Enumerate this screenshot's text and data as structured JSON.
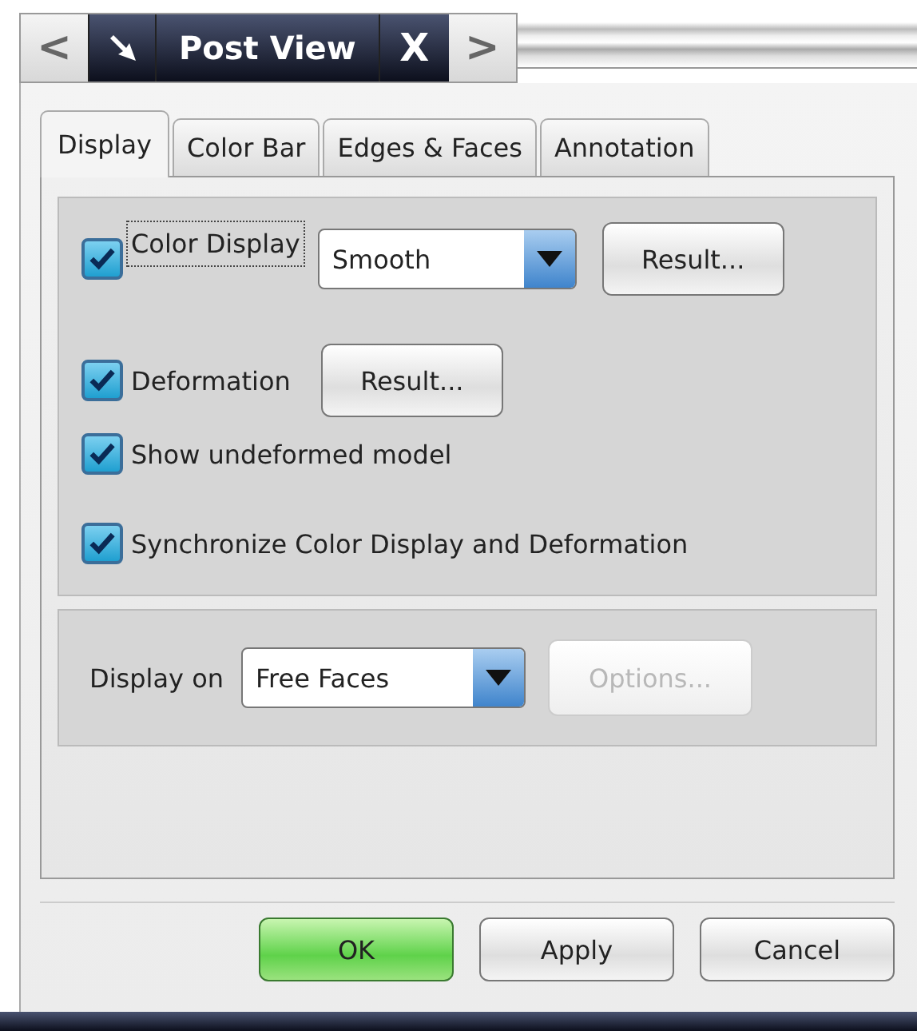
{
  "title_bar": {
    "back": "<",
    "title": "Post View",
    "close": "X",
    "forward": ">"
  },
  "tabs": [
    {
      "label": "Display",
      "selected": true
    },
    {
      "label": "Color Bar",
      "selected": false
    },
    {
      "label": "Edges & Faces",
      "selected": false
    },
    {
      "label": "Annotation",
      "selected": false
    }
  ],
  "display_group": {
    "color_display": {
      "label": "Color Display",
      "checked": true,
      "focused": true,
      "mode": "Smooth",
      "button": "Result..."
    },
    "deformation": {
      "label": "Deformation",
      "checked": true,
      "button": "Result..."
    },
    "show_undeformed": {
      "label": "Show undeformed model",
      "checked": true
    },
    "synchronize": {
      "label": "Synchronize Color Display and Deformation",
      "checked": true
    }
  },
  "display_on": {
    "label": "Display on",
    "value": "Free Faces",
    "button": {
      "label": "Options...",
      "disabled": true
    }
  },
  "buttons": [
    {
      "label": "OK",
      "default": true
    },
    {
      "label": "Apply",
      "default": false
    },
    {
      "label": "Cancel",
      "default": false
    }
  ]
}
